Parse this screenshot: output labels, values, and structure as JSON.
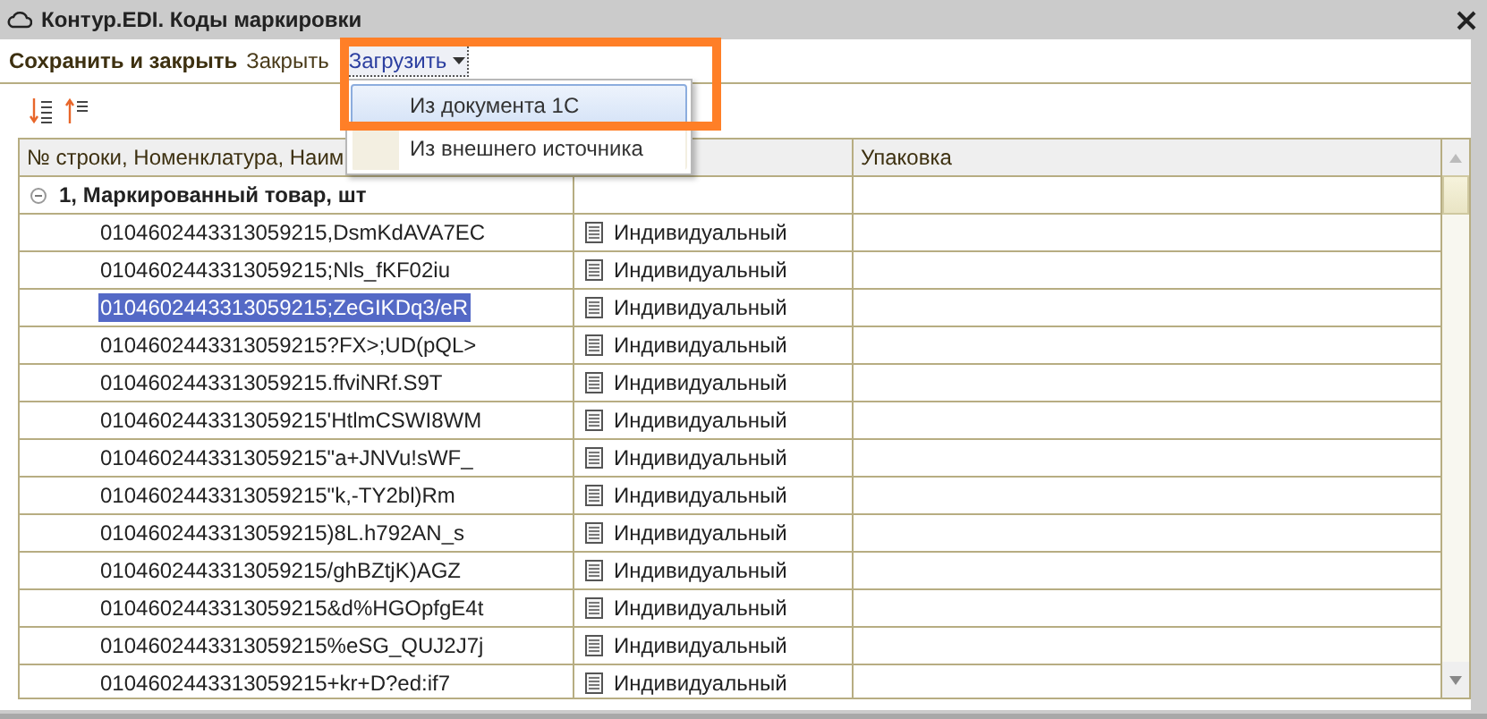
{
  "window": {
    "title": "Контур.EDI. Коды маркировки"
  },
  "toolbar": {
    "buttons": [
      {
        "label": "Сохранить и закрыть",
        "kind": "primary"
      },
      {
        "label": "Закрыть",
        "kind": "plain"
      },
      {
        "label": "Загрузить",
        "kind": "menu"
      }
    ]
  },
  "menu": {
    "items": [
      {
        "label": "Из документа 1С",
        "selected": true
      },
      {
        "label": "Из внешнего источника",
        "selected": false
      }
    ]
  },
  "table": {
    "columns": [
      "№ строки, Номенклатура, Наим",
      "",
      "Упаковка"
    ],
    "group": {
      "label": "1, Маркированный товар, шт",
      "expanded": true
    },
    "rows": [
      {
        "code": "0104602443313059215,DsmKdAVA7EC",
        "packaging": "Индивидуальный",
        "selected": false
      },
      {
        "code": "0104602443313059215;Nls_fKF02iu",
        "packaging": "Индивидуальный",
        "selected": false
      },
      {
        "code": "0104602443313059215;ZeGIKDq3/eR",
        "packaging": "Индивидуальный",
        "selected": true
      },
      {
        "code": "0104602443313059215?FX>;UD(pQL>",
        "packaging": "Индивидуальный",
        "selected": false
      },
      {
        "code": "0104602443313059215.ffviNRf.S9T",
        "packaging": "Индивидуальный",
        "selected": false
      },
      {
        "code": "0104602443313059215'HtlmCSWI8WM",
        "packaging": "Индивидуальный",
        "selected": false
      },
      {
        "code": "0104602443313059215\"a+JNVu!sWF_",
        "packaging": "Индивидуальный",
        "selected": false
      },
      {
        "code": "0104602443313059215\"k,-TY2bl)Rm",
        "packaging": "Индивидуальный",
        "selected": false
      },
      {
        "code": "0104602443313059215)8L.h792AN_s",
        "packaging": "Индивидуальный",
        "selected": false
      },
      {
        "code": "0104602443313059215/ghBZtjK)AGZ",
        "packaging": "Индивидуальный",
        "selected": false
      },
      {
        "code": "0104602443313059215&d%HGOpfgE4t",
        "packaging": "Индивидуальный",
        "selected": false
      },
      {
        "code": "0104602443313059215%eSG_QUJ2J7j",
        "packaging": "Индивидуальный",
        "selected": false
      },
      {
        "code": "0104602443313059215+kr+D?ed:if7",
        "packaging": "Индивидуальный",
        "selected": false
      }
    ]
  }
}
